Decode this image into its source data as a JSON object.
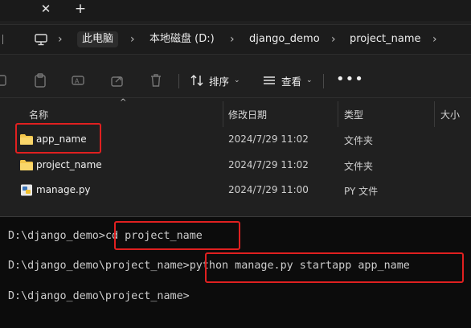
{
  "window": {
    "tab_close_glyph": "✕",
    "tab_new_glyph": "+"
  },
  "breadcrumb": [
    {
      "label": "此电脑"
    },
    {
      "label": "本地磁盘 (D:)"
    },
    {
      "label": "django_demo"
    },
    {
      "label": "project_name"
    }
  ],
  "toolbar": {
    "sort_label": "排序",
    "view_label": "查看",
    "more_label": "•••"
  },
  "columns": {
    "name": "名称",
    "date": "修改日期",
    "type": "类型",
    "size": "大小"
  },
  "files": [
    {
      "name": "app_name",
      "date": "2024/7/29 11:02",
      "type": "文件夹",
      "icon": "folder-icon"
    },
    {
      "name": "project_name",
      "date": "2024/7/29 11:02",
      "type": "文件夹",
      "icon": "folder-icon"
    },
    {
      "name": "manage.py",
      "date": "2024/7/29 11:00",
      "type": "PY 文件",
      "icon": "python-file-icon"
    }
  ],
  "terminal": {
    "line1_prompt": "D:\\django_demo>",
    "line1_command": "cd project_name",
    "line2_prompt": "D:\\django_demo\\project_name>",
    "line2_command": "python manage.py startapp app_name",
    "line3_prompt": "D:\\django_demo\\project_name>"
  },
  "colors": {
    "highlight": "#e02020",
    "folder": "#f3c64b",
    "background": "#0c0c0c"
  }
}
